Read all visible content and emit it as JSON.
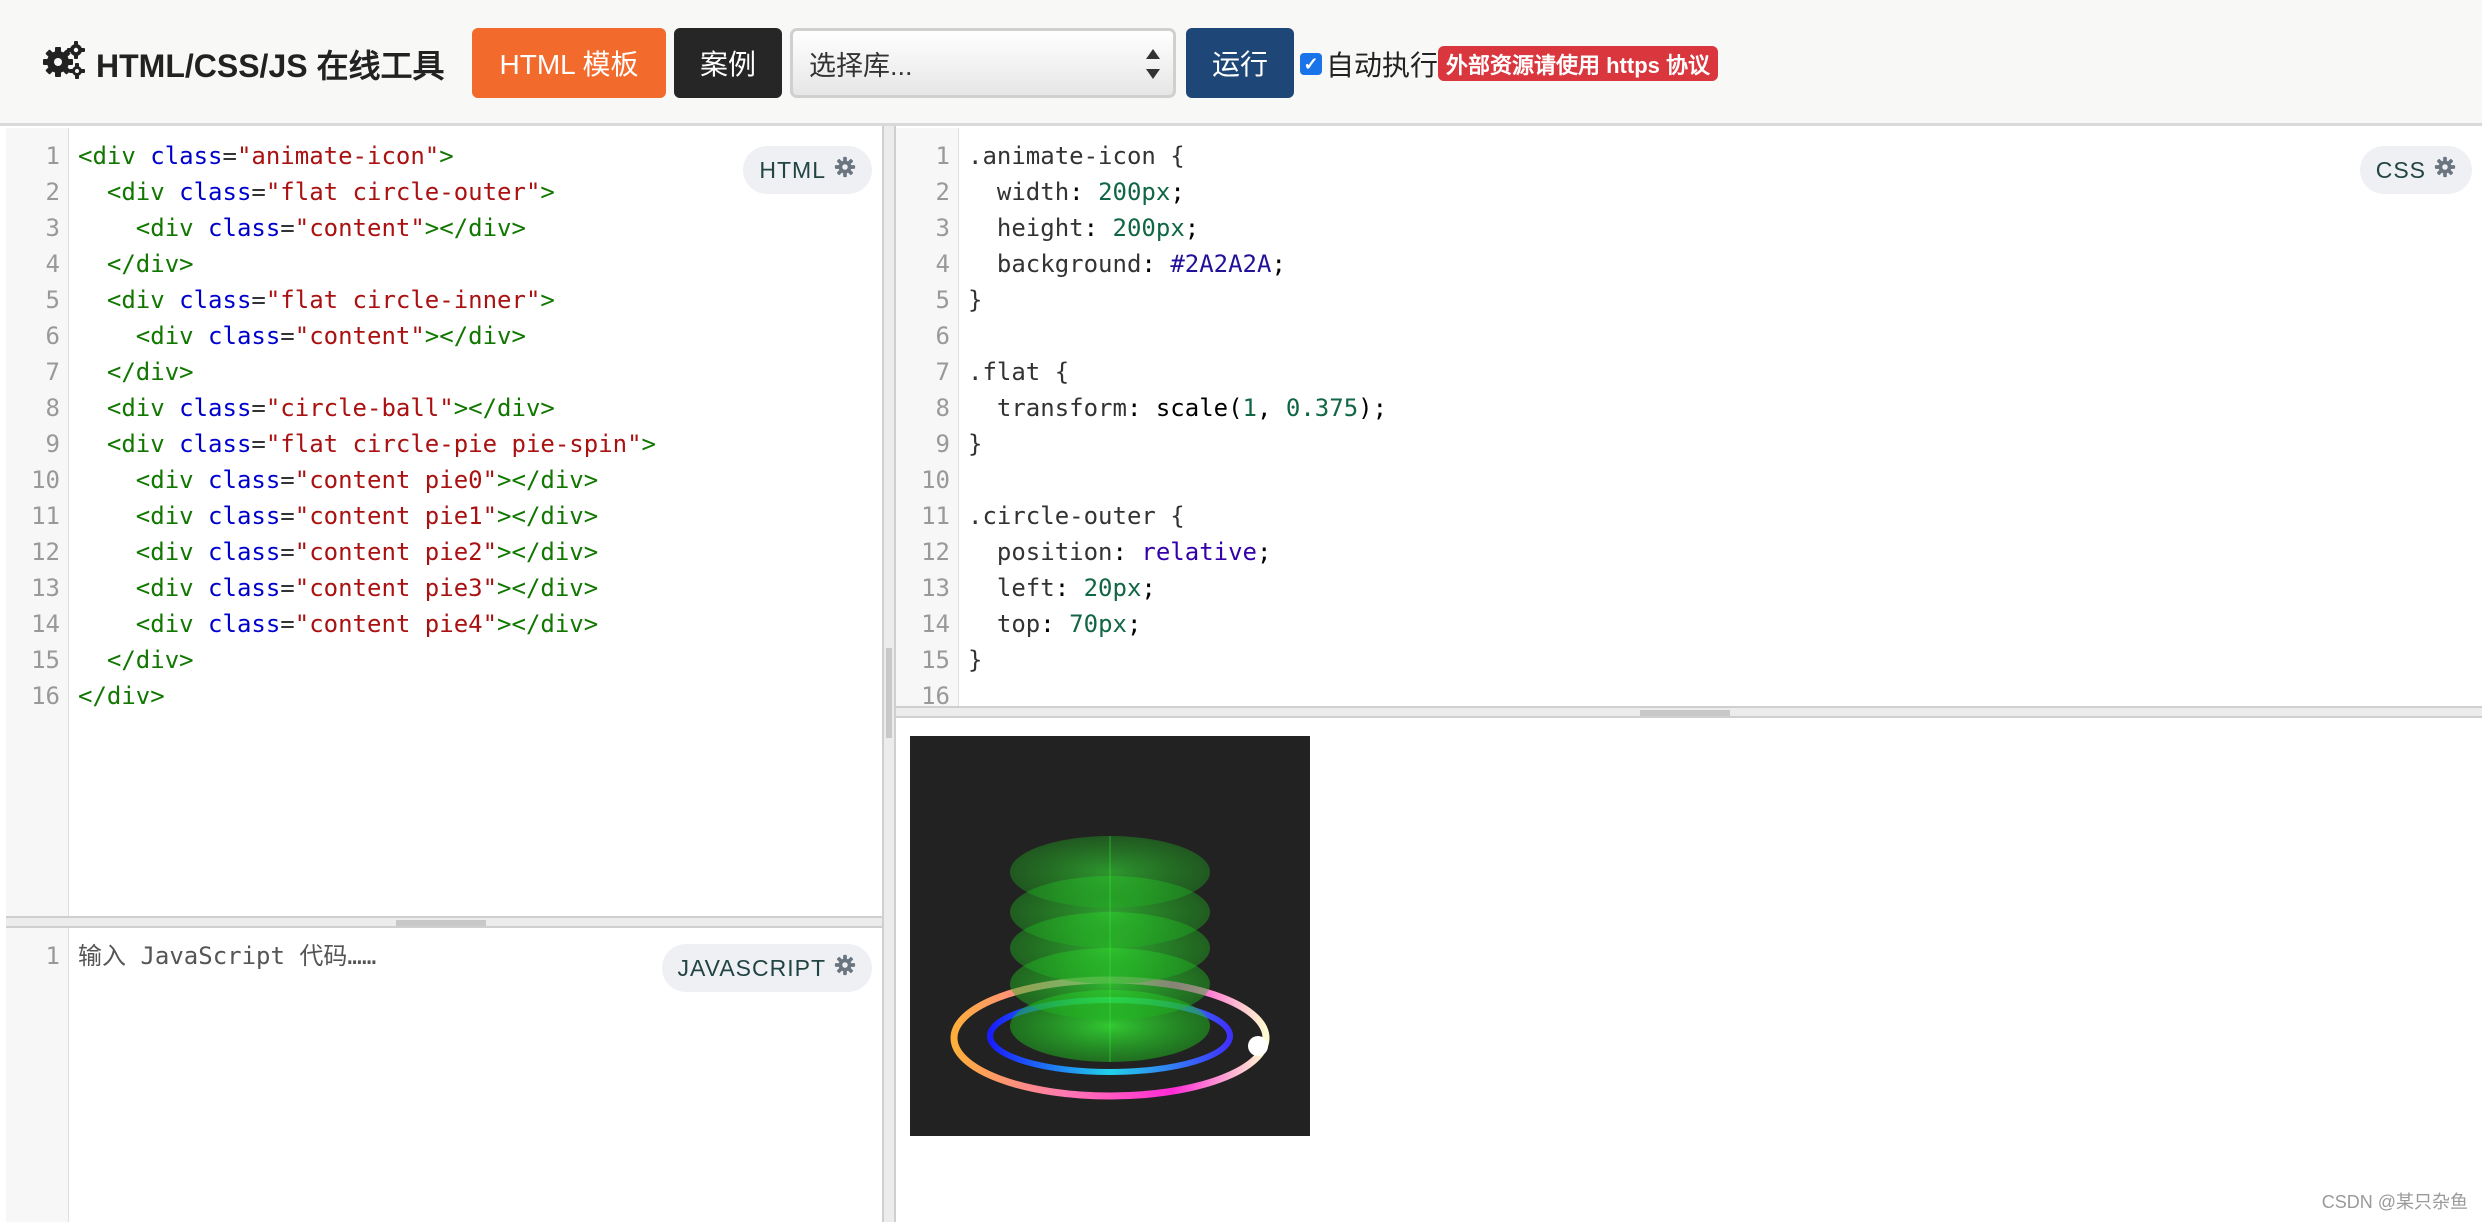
{
  "toolbar": {
    "title": "HTML/CSS/JS 在线工具",
    "template_button": "HTML 模板",
    "case_button": "案例",
    "library_select": "选择库...",
    "run_button": "运行",
    "autorun_label": "自动执行",
    "autorun_checked": true,
    "warning_badge": "外部资源请使用 https 协议",
    "colors": {
      "template": "#f26b2c",
      "case": "#262626",
      "run": "#1e4677",
      "warning": "#d9363e"
    }
  },
  "html_editor": {
    "badge": "HTML",
    "line_numbers": [
      "1",
      "2",
      "3",
      "4",
      "5",
      "6",
      "7",
      "8",
      "9",
      "10",
      "11",
      "12",
      "13",
      "14",
      "15",
      "16"
    ],
    "lines": [
      "<div class=\"animate-icon\">",
      "  <div class=\"flat circle-outer\">",
      "    <div class=\"content\"></div>",
      "  </div>",
      "  <div class=\"flat circle-inner\">",
      "    <div class=\"content\"></div>",
      "  </div>",
      "  <div class=\"circle-ball\"></div>",
      "  <div class=\"flat circle-pie pie-spin\">",
      "    <div class=\"content pie0\"></div>",
      "    <div class=\"content pie1\"></div>",
      "    <div class=\"content pie2\"></div>",
      "    <div class=\"content pie3\"></div>",
      "    <div class=\"content pie4\"></div>",
      "  </div>",
      "</div>"
    ]
  },
  "css_editor": {
    "badge": "CSS",
    "line_numbers": [
      "1",
      "2",
      "3",
      "4",
      "5",
      "6",
      "7",
      "8",
      "9",
      "10",
      "11",
      "12",
      "13",
      "14",
      "15",
      "16"
    ],
    "lines": [
      ".animate-icon {",
      "  width: 200px;",
      "  height: 200px;",
      "  background: #2A2A2A;",
      "}",
      "",
      ".flat {",
      "  transform: scale(1, 0.375);",
      "}",
      "",
      ".circle-outer {",
      "  position: relative;",
      "  left: 20px;",
      "  top: 70px;",
      "}",
      ""
    ]
  },
  "js_editor": {
    "badge": "JAVASCRIPT",
    "line_numbers": [
      "1"
    ],
    "placeholder": "输入 JavaScript 代码……"
  },
  "preview": {
    "background": "#222222",
    "cylinder_color": "#2fd62f"
  },
  "watermark": "CSDN @某只杂鱼"
}
